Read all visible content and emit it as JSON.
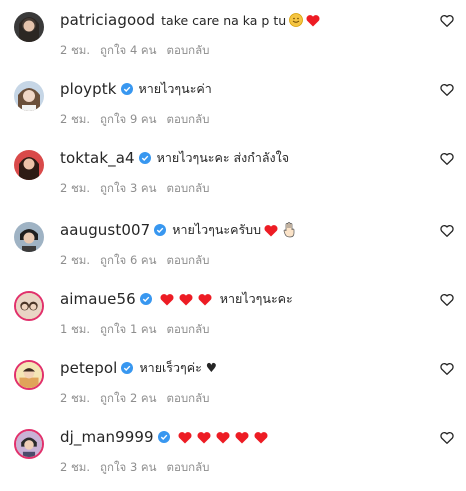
{
  "comments": [
    {
      "username": "patriciagood",
      "verified": false,
      "text": "take care na ka p tu",
      "emojis": [
        "smile-emoji",
        "red-heart"
      ],
      "time": "2 ชม.",
      "likes": "ถูกใจ 4 คน",
      "reply": "ตอบกลับ"
    },
    {
      "username": "ployptk",
      "verified": true,
      "text": "หายไวๆนะค่า",
      "emojis": [],
      "time": "2 ชม.",
      "likes": "ถูกใจ 9 คน",
      "reply": "ตอบกลับ"
    },
    {
      "username": "toktak_a4",
      "verified": true,
      "text": "หายไวๆนะคะ ส่งกำลังใจ",
      "emojis": [],
      "time": "2 ชม.",
      "likes": "ถูกใจ 3 คน",
      "reply": "ตอบกลับ"
    },
    {
      "username": "aaugust007",
      "verified": true,
      "text": "หายไวๆนะครับบ",
      "emojis": [
        "red-heart",
        "hand-emoji"
      ],
      "time": "2 ชม.",
      "likes": "ถูกใจ 6 คน",
      "reply": "ตอบกลับ"
    },
    {
      "username": "aimaue56",
      "verified": true,
      "text": "หายไวๆนะคะ",
      "emojis_before": [
        "red-heart",
        "red-heart",
        "red-heart"
      ],
      "emojis": [],
      "time": "1 ชม.",
      "likes": "ถูกใจ 1 คน",
      "reply": "ตอบกลับ"
    },
    {
      "username": "petepol",
      "verified": true,
      "text": "หายเร็วๆค่ะ ♥",
      "emojis": [],
      "time": "2 ชม.",
      "likes": "ถูกใจ 2 คน",
      "reply": "ตอบกลับ"
    },
    {
      "username": "dj_man9999",
      "verified": true,
      "text": "",
      "emojis_before": [
        "red-heart",
        "red-heart",
        "red-heart",
        "red-heart",
        "red-heart"
      ],
      "emojis": [],
      "time": "2 ชม.",
      "likes": "ถูกใจ 3 คน",
      "reply": "ตอบกลับ"
    }
  ],
  "colors": {
    "verified": "#3897f0",
    "heart": "#ed1c24",
    "muted": "#8e8e8e"
  }
}
